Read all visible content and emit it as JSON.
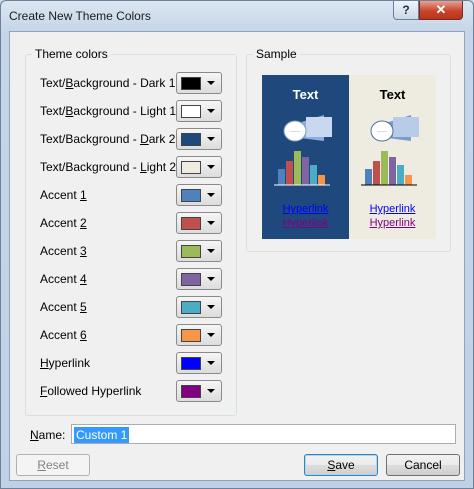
{
  "window": {
    "title": "Create New Theme Colors",
    "help_label": "?",
    "close_label": "✕"
  },
  "theme_colors": {
    "title": "Theme colors",
    "rows": [
      {
        "label": "Text/Background - Dark 1",
        "color": "#000000"
      },
      {
        "label": "Text/Background - Light 1",
        "color": "#ffffff"
      },
      {
        "label": "Text/Background - Dark 2",
        "color": "#1f497d"
      },
      {
        "label": "Text/Background - Light 2",
        "color": "#eeece1"
      },
      {
        "label": "Accent 1",
        "color": "#4f81bd"
      },
      {
        "label": "Accent 2",
        "color": "#c0504d"
      },
      {
        "label": "Accent 3",
        "color": "#9bbb59"
      },
      {
        "label": "Accent 4",
        "color": "#8064a2"
      },
      {
        "label": "Accent 5",
        "color": "#4bacc6"
      },
      {
        "label": "Accent 6",
        "color": "#f79646"
      },
      {
        "label": "Hyperlink",
        "color": "#0000ff"
      },
      {
        "label": "Followed Hyperlink",
        "color": "#800080"
      }
    ]
  },
  "sample": {
    "title": "Sample",
    "text_label": "Text",
    "hyperlink_label": "Hyperlink",
    "followed_label": "Hyperlink"
  },
  "name_field": {
    "label": "Name:",
    "value": "Custom 1"
  },
  "buttons": {
    "reset": "Reset",
    "save": "Save",
    "cancel": "Cancel"
  }
}
